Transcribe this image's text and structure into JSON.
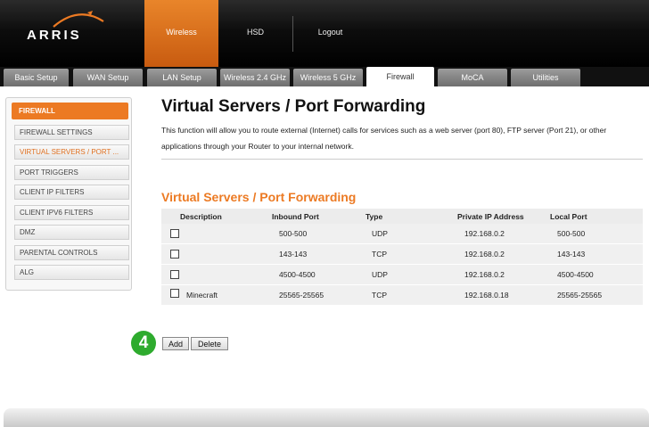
{
  "header": {
    "logo": "ARRIS",
    "nav": [
      {
        "label": "Wireless",
        "active": true
      },
      {
        "label": "HSD",
        "active": false
      },
      {
        "label": "Logout",
        "active": false
      }
    ]
  },
  "tabs": [
    {
      "label": "Basic Setup",
      "active": false
    },
    {
      "label": "WAN Setup",
      "active": false
    },
    {
      "label": "LAN Setup",
      "active": false
    },
    {
      "label": "Wireless 2.4 GHz",
      "active": false
    },
    {
      "label": "Wireless 5 GHz",
      "active": false
    },
    {
      "label": "Firewall",
      "active": true
    },
    {
      "label": "MoCA",
      "active": false
    },
    {
      "label": "Utilities",
      "active": false
    }
  ],
  "sidebar": {
    "heading": "FIREWALL",
    "items": [
      {
        "label": "FIREWALL SETTINGS",
        "active": false
      },
      {
        "label": "VIRTUAL SERVERS / PORT ...",
        "active": true
      },
      {
        "label": "PORT TRIGGERS",
        "active": false
      },
      {
        "label": "CLIENT IP FILTERS",
        "active": false
      },
      {
        "label": "CLIENT IPV6 FILTERS",
        "active": false
      },
      {
        "label": "DMZ",
        "active": false
      },
      {
        "label": "PARENTAL CONTROLS",
        "active": false
      },
      {
        "label": "ALG",
        "active": false
      }
    ]
  },
  "main": {
    "title": "Virtual Servers / Port Forwarding",
    "description": "This function will allow you to route external (Internet) calls for services such as a web server (port 80), FTP server (Port 21), or other applications through your Router to your internal network.",
    "section_title": "Virtual Servers / Port Forwarding",
    "columns": [
      "Description",
      "Inbound Port",
      "Type",
      "Private IP Address",
      "Local Port"
    ],
    "rows": [
      {
        "checked": false,
        "description": "",
        "inbound_port": "500-500",
        "type": "UDP",
        "private_ip": "192.168.0.2",
        "local_port": "500-500"
      },
      {
        "checked": false,
        "description": "",
        "inbound_port": "143-143",
        "type": "TCP",
        "private_ip": "192.168.0.2",
        "local_port": "143-143"
      },
      {
        "checked": false,
        "description": "",
        "inbound_port": "4500-4500",
        "type": "UDP",
        "private_ip": "192.168.0.2",
        "local_port": "4500-4500"
      },
      {
        "checked": false,
        "description": "Minecraft",
        "inbound_port": "25565-25565",
        "type": "TCP",
        "private_ip": "192.168.0.18",
        "local_port": "25565-25565"
      }
    ],
    "step_badge": "4",
    "add_label": "Add",
    "delete_label": "Delete"
  },
  "colors": {
    "accent": "#ec7a23",
    "badge": "#2eab2e"
  }
}
